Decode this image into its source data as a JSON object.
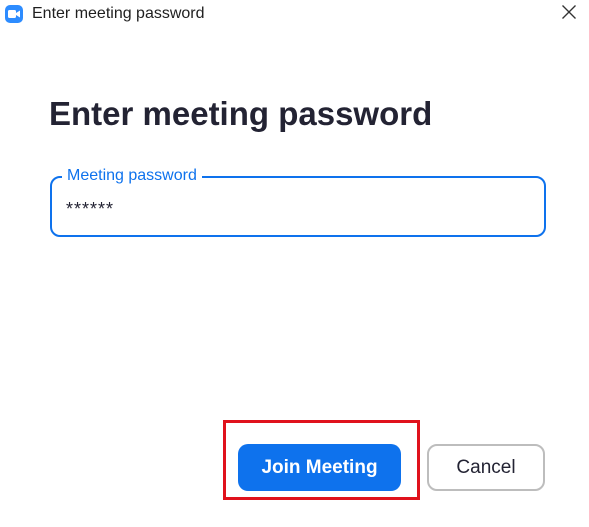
{
  "window": {
    "title": "Enter meeting password",
    "app_icon": "zoom-camera-icon",
    "close_icon": "close-icon"
  },
  "dialog": {
    "heading": "Enter meeting password",
    "password_field": {
      "label": "Meeting password",
      "value": "******"
    },
    "buttons": {
      "join_label": "Join Meeting",
      "cancel_label": "Cancel"
    }
  },
  "colors": {
    "accent": "#0e72ed",
    "highlight": "#e0121c",
    "heading": "#232333"
  }
}
